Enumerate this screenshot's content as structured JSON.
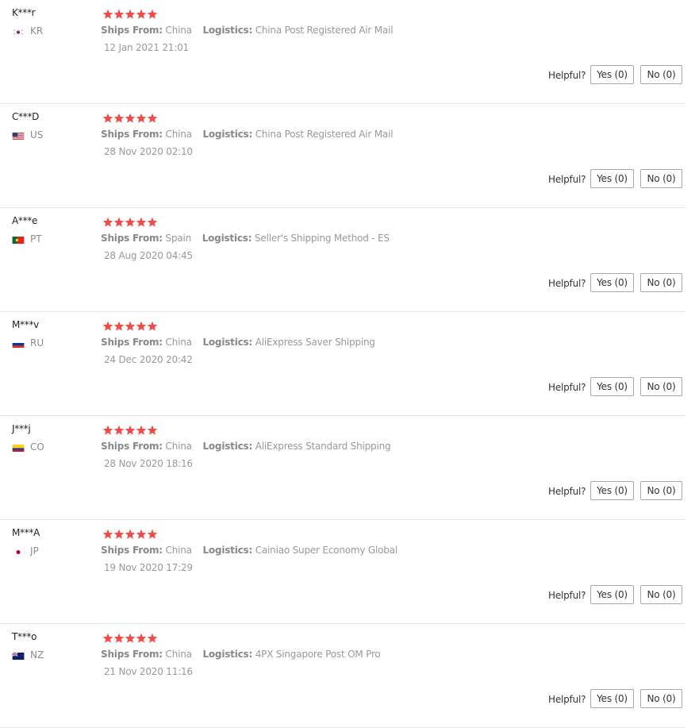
{
  "colors": {
    "star": "#f04b48",
    "divider": "#e6e6e6",
    "muted_text": "#999999"
  },
  "labels": {
    "ships_from": "Ships From:",
    "logistics": "Logistics:",
    "helpful": "Helpful?"
  },
  "reviews": [
    {
      "user": "K***r",
      "country": "KR",
      "flag": "kr-flag-icon",
      "rating": 5,
      "ships_from": "China",
      "logistics": "China Post Registered Air Mail",
      "date": "12 Jan 2021 21:01",
      "yes": "Yes (0)",
      "no": "No (0)"
    },
    {
      "user": "C***D",
      "country": "US",
      "flag": "us-flag-icon",
      "rating": 5,
      "ships_from": "China",
      "logistics": "China Post Registered Air Mail",
      "date": "28 Nov 2020 02:10",
      "yes": "Yes (0)",
      "no": "No (0)"
    },
    {
      "user": "A***e",
      "country": "PT",
      "flag": "pt-flag-icon",
      "rating": 5,
      "ships_from": "Spain",
      "logistics": "Seller's Shipping Method - ES",
      "date": "28 Aug 2020 04:45",
      "yes": "Yes (0)",
      "no": "No (0)"
    },
    {
      "user": "M***v",
      "country": "RU",
      "flag": "ru-flag-icon",
      "rating": 5,
      "ships_from": "China",
      "logistics": "AliExpress Saver Shipping",
      "date": "24 Dec 2020 20:42",
      "yes": "Yes (0)",
      "no": "No (0)"
    },
    {
      "user": "J***j",
      "country": "CO",
      "flag": "co-flag-icon",
      "rating": 5,
      "ships_from": "China",
      "logistics": "AliExpress Standard Shipping",
      "date": "28 Nov 2020 18:16",
      "yes": "Yes (0)",
      "no": "No (0)"
    },
    {
      "user": "M***A",
      "country": "JP",
      "flag": "jp-flag-icon",
      "rating": 5,
      "ships_from": "China",
      "logistics": "Cainiao Super Economy Global",
      "date": "19 Nov 2020 17:29",
      "yes": "Yes (0)",
      "no": "No (0)"
    },
    {
      "user": "T***o",
      "country": "NZ",
      "flag": "nz-flag-icon",
      "rating": 5,
      "ships_from": "China",
      "logistics": "4PX Singapore Post OM Pro",
      "date": "21 Nov 2020 11:16",
      "yes": "Yes (0)",
      "no": "No (0)"
    }
  ]
}
